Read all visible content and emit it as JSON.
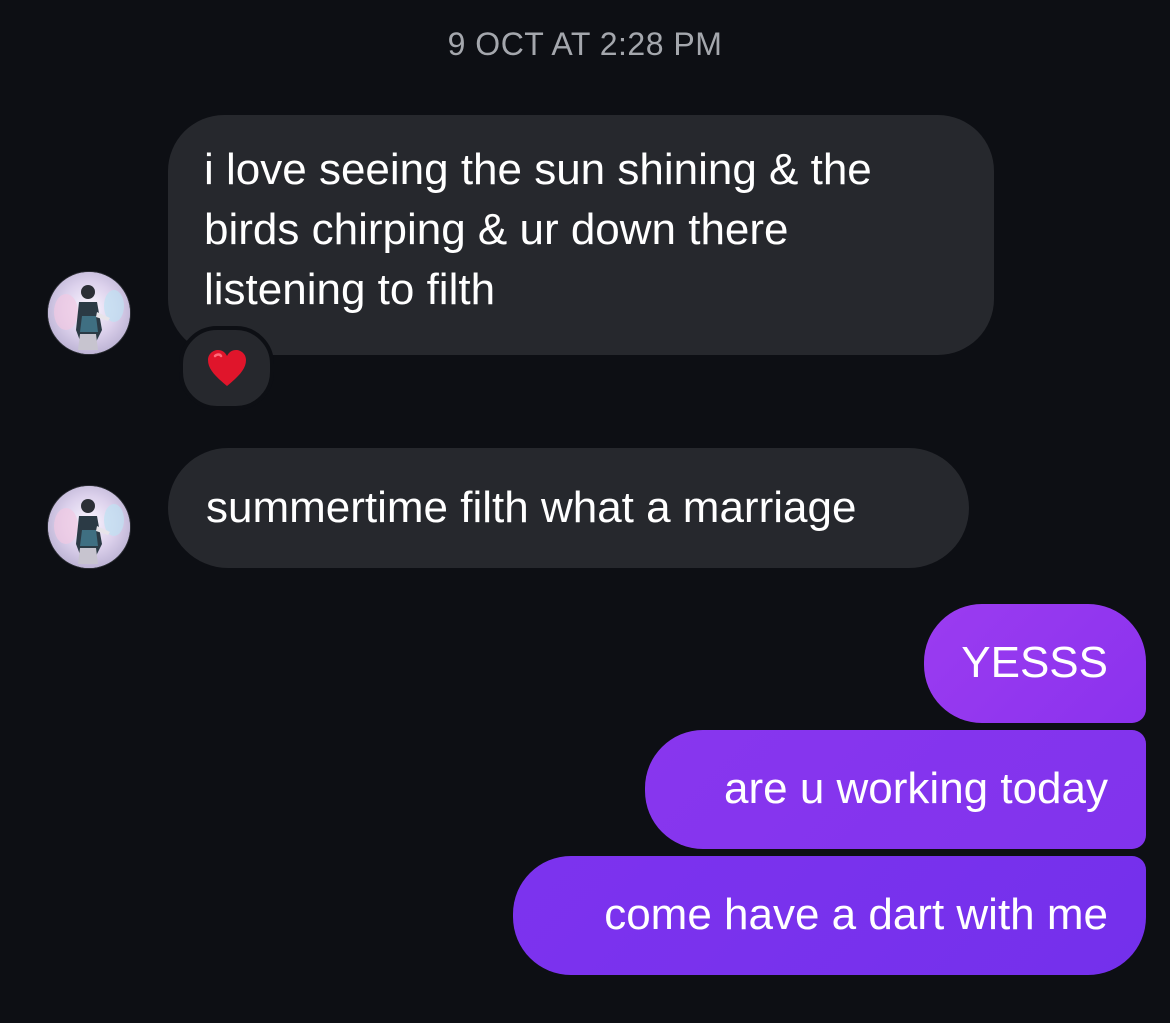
{
  "conversation": {
    "timestamp": "9 OCT AT 2:28 PM",
    "messages": [
      {
        "direction": "incoming",
        "text": "i love seeing the sun shining & the\nbirds chirping & ur down there\nlistening to filth",
        "reaction": "heart-emoji"
      },
      {
        "direction": "incoming",
        "text": "summertime filth what a marriage"
      },
      {
        "direction": "outgoing",
        "text": "YESSS"
      },
      {
        "direction": "outgoing",
        "text": "are u working today"
      },
      {
        "direction": "outgoing",
        "text": "come have a dart with me"
      }
    ]
  },
  "colors": {
    "background": "#0d0f14",
    "incoming_bubble": "#26282d",
    "outgoing_bubble_top": "#9b3cf0",
    "outgoing_bubble_bottom": "#7430ec",
    "timestamp_text": "#a4a7ad",
    "reaction_heart": "#e0152b"
  },
  "icons": {
    "avatar": "contact-avatar-photo",
    "reaction": "red-heart-emoji"
  }
}
